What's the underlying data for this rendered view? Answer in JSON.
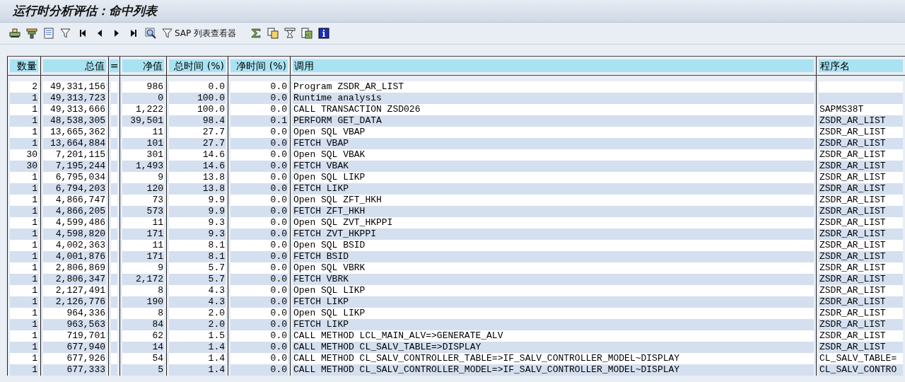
{
  "window": {
    "title": "运行时分析评估：命中列表"
  },
  "toolbar": [
    {
      "kind": "print"
    },
    {
      "kind": "layout"
    },
    {
      "kind": "document"
    },
    {
      "kind": "filter"
    },
    {
      "kind": "first"
    },
    {
      "kind": "previous"
    },
    {
      "kind": "next"
    },
    {
      "kind": "last"
    },
    {
      "kind": "find"
    },
    {
      "kind": "filter",
      "label": "SAP 列表查看器"
    },
    {
      "kind": "sum"
    },
    {
      "kind": "copy"
    },
    {
      "kind": "hourglass"
    },
    {
      "kind": "export"
    },
    {
      "kind": "info"
    }
  ],
  "table": {
    "columns": [
      "数量",
      "总值",
      "=",
      "净值",
      "总时间 (%)",
      "净时间 (%)",
      "调用",
      "程序名"
    ],
    "rows": [
      [
        "2",
        "49,331,156",
        "",
        "986",
        "0.0",
        "0.0",
        "Program ZSDR_AR_LIST",
        ""
      ],
      [
        "1",
        "49,313,723",
        "",
        "0",
        "100.0",
        "0.0",
        "Runtime analysis",
        ""
      ],
      [
        "1",
        "49,313,666",
        "",
        "1,222",
        "100.0",
        "0.0",
        "CALL TRANSACTION ZSD026",
        "SAPMS38T"
      ],
      [
        "1",
        "48,538,305",
        "",
        "39,501",
        "98.4",
        "0.1",
        "PERFORM GET_DATA",
        "ZSDR_AR_LIST"
      ],
      [
        "1",
        "13,665,362",
        "",
        "11",
        "27.7",
        "0.0",
        "Open SQL VBAP",
        "ZSDR_AR_LIST"
      ],
      [
        "1",
        "13,664,884",
        "",
        "101",
        "27.7",
        "0.0",
        "FETCH VBAP",
        "ZSDR_AR_LIST"
      ],
      [
        "30",
        "7,201,115",
        "",
        "301",
        "14.6",
        "0.0",
        "Open SQL VBAK",
        "ZSDR_AR_LIST"
      ],
      [
        "30",
        "7,195,244",
        "",
        "1,493",
        "14.6",
        "0.0",
        "FETCH VBAK",
        "ZSDR_AR_LIST"
      ],
      [
        "1",
        "6,795,034",
        "",
        "9",
        "13.8",
        "0.0",
        "Open SQL LIKP",
        "ZSDR_AR_LIST"
      ],
      [
        "1",
        "6,794,203",
        "",
        "120",
        "13.8",
        "0.0",
        "FETCH LIKP",
        "ZSDR_AR_LIST"
      ],
      [
        "1",
        "4,866,747",
        "",
        "73",
        "9.9",
        "0.0",
        "Open SQL ZFT_HKH",
        "ZSDR_AR_LIST"
      ],
      [
        "1",
        "4,866,205",
        "",
        "573",
        "9.9",
        "0.0",
        "FETCH ZFT_HKH",
        "ZSDR_AR_LIST"
      ],
      [
        "1",
        "4,599,486",
        "",
        "11",
        "9.3",
        "0.0",
        "Open SQL ZVT_HKPPI",
        "ZSDR_AR_LIST"
      ],
      [
        "1",
        "4,598,820",
        "",
        "171",
        "9.3",
        "0.0",
        "FETCH ZVT_HKPPI",
        "ZSDR_AR_LIST"
      ],
      [
        "1",
        "4,002,363",
        "",
        "11",
        "8.1",
        "0.0",
        "Open SQL BSID",
        "ZSDR_AR_LIST"
      ],
      [
        "1",
        "4,001,876",
        "",
        "171",
        "8.1",
        "0.0",
        "FETCH BSID",
        "ZSDR_AR_LIST"
      ],
      [
        "1",
        "2,806,869",
        "",
        "9",
        "5.7",
        "0.0",
        "Open SQL VBRK",
        "ZSDR_AR_LIST"
      ],
      [
        "1",
        "2,806,347",
        "",
        "2,172",
        "5.7",
        "0.0",
        "FETCH VBRK",
        "ZSDR_AR_LIST"
      ],
      [
        "1",
        "2,127,491",
        "",
        "8",
        "4.3",
        "0.0",
        "Open SQL LIKP",
        "ZSDR_AR_LIST"
      ],
      [
        "1",
        "2,126,776",
        "",
        "190",
        "4.3",
        "0.0",
        "FETCH LIKP",
        "ZSDR_AR_LIST"
      ],
      [
        "1",
        "964,336",
        "",
        "8",
        "2.0",
        "0.0",
        "Open SQL LIKP",
        "ZSDR_AR_LIST"
      ],
      [
        "1",
        "963,563",
        "",
        "84",
        "2.0",
        "0.0",
        "FETCH LIKP",
        "ZSDR_AR_LIST"
      ],
      [
        "1",
        "719,701",
        "",
        "62",
        "1.5",
        "0.0",
        "CALL METHOD LCL_MAIN_ALV=>GENERATE_ALV",
        "ZSDR_AR_LIST"
      ],
      [
        "1",
        "677,940",
        "",
        "14",
        "1.4",
        "0.0",
        "CALL METHOD CL_SALV_TABLE=>DISPLAY",
        "ZSDR_AR_LIST"
      ],
      [
        "1",
        "677,926",
        "",
        "54",
        "1.4",
        "0.0",
        "CALL METHOD CL_SALV_CONTROLLER_TABLE=>IF_SALV_CONTROLLER_MODEL~DISPLAY",
        "CL_SALV_TABLE="
      ],
      [
        "1",
        "677,333",
        "",
        "5",
        "1.4",
        "0.0",
        "CALL METHOD CL_SALV_CONTROLLER_MODEL=>IF_SALV_CONTROLLER_MODEL~DISPLAY",
        "CL_SALV_CONTRO"
      ]
    ]
  }
}
